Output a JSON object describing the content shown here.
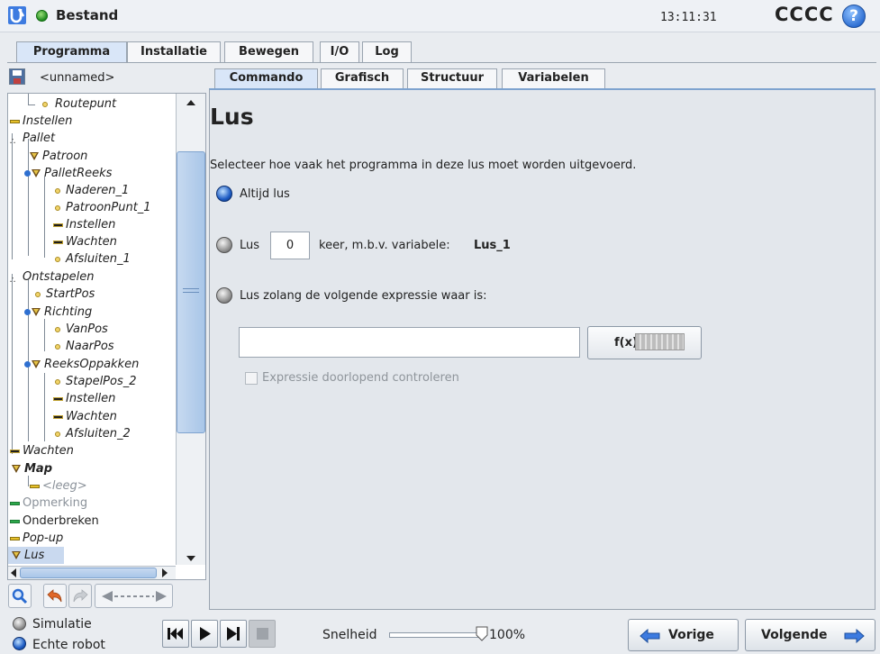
{
  "header": {
    "file_title": "Bestand",
    "clock": "13:11:31",
    "robot_name": "CCCC",
    "help_glyph": "?"
  },
  "main_tabs": [
    {
      "label": "Programma",
      "active": true
    },
    {
      "label": "Installatie",
      "active": false
    },
    {
      "label": "Bewegen",
      "active": false
    },
    {
      "label": "I/O",
      "active": false
    },
    {
      "label": "Log",
      "active": false
    }
  ],
  "program": {
    "name": "<unnamed>"
  },
  "tree": [
    {
      "label": "Routepunt",
      "icon": "waypoint-icon"
    },
    {
      "label": "Instellen",
      "icon": "set-icon"
    },
    {
      "label": "Pallet",
      "icon": "pallet-icon"
    },
    {
      "label": "Patroon",
      "icon": "folder-icon"
    },
    {
      "label": "PalletReeks",
      "icon": "folder-icon"
    },
    {
      "label": "Naderen_1",
      "icon": "waypoint-icon"
    },
    {
      "label": "PatroonPunt_1",
      "icon": "waypoint-icon"
    },
    {
      "label": "Instellen",
      "icon": "set-icon"
    },
    {
      "label": "Wachten",
      "icon": "wait-icon"
    },
    {
      "label": "Afsluiten_1",
      "icon": "waypoint-icon"
    },
    {
      "label": "Ontstapelen",
      "icon": "pallet-icon"
    },
    {
      "label": "StartPos",
      "icon": "waypoint-icon"
    },
    {
      "label": "Richting",
      "icon": "folder-icon"
    },
    {
      "label": "VanPos",
      "icon": "waypoint-icon"
    },
    {
      "label": "NaarPos",
      "icon": "waypoint-icon"
    },
    {
      "label": "ReeksOppakken",
      "icon": "folder-icon"
    },
    {
      "label": "StapelPos_2",
      "icon": "waypoint-icon"
    },
    {
      "label": "Instellen",
      "icon": "set-icon"
    },
    {
      "label": "Wachten",
      "icon": "wait-icon"
    },
    {
      "label": "Afsluiten_2",
      "icon": "waypoint-icon"
    },
    {
      "label": "Wachten",
      "icon": "wait-icon"
    },
    {
      "label": "Map",
      "icon": "folder-icon"
    },
    {
      "label": "<leeg>",
      "icon": "empty-icon"
    },
    {
      "label": "Opmerking",
      "icon": "comment-icon"
    },
    {
      "label": "Onderbreken",
      "icon": "halt-icon"
    },
    {
      "label": "Pop-up",
      "icon": "popup-icon"
    },
    {
      "label": "Lus",
      "icon": "loop-icon",
      "selected": true
    }
  ],
  "right_tabs": [
    {
      "label": "Commando",
      "active": true
    },
    {
      "label": "Grafisch",
      "active": false
    },
    {
      "label": "Structuur",
      "active": false
    },
    {
      "label": "Variabelen",
      "active": false
    }
  ],
  "command": {
    "title": "Lus",
    "description": "Selecteer hoe vaak het programma in deze lus moet worden uitgevoerd.",
    "option_always": "Altijd lus",
    "option_count_prefix": "Lus",
    "count_value": "0",
    "option_count_suffix": "keer, m.b.v. variabele:",
    "count_variable": "Lus_1",
    "option_expr": "Lus zolang de volgende expressie waar is:",
    "expr_value": "",
    "fx_label": "f(x)",
    "check_label": "Expressie doorlopend controleren",
    "selected_option": "always"
  },
  "bottom": {
    "mode_sim": "Simulatie",
    "mode_real": "Echte robot",
    "speed_label": "Snelheid",
    "speed_value": "100%",
    "speed_fraction": 1.0,
    "prev_label": "Vorige",
    "next_label": "Volgende"
  },
  "colors": {
    "accent": "#d9e6f8",
    "selected_radio": "#1e5cc4",
    "status_green": "#1f8a1f"
  }
}
